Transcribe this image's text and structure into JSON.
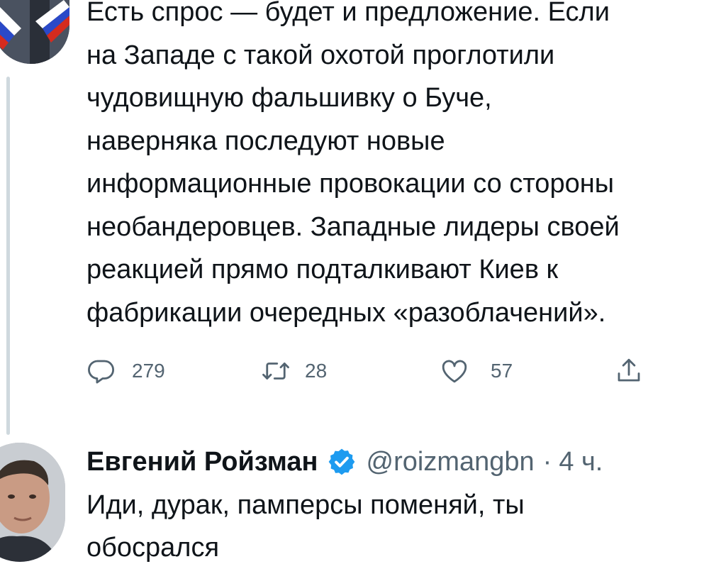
{
  "tweet1": {
    "lines": [
      "Есть спрос — будет и предложение. Если",
      "на Западе с такой охотой проглотили",
      "чудовищную фальшивку о Буче,",
      "наверняка последуют новые",
      "информационные провокации со стороны",
      "необандеровцев. Западные лидеры своей",
      "реакцией прямо подталкивают Киев к",
      "фабрикации очередных «разоблачений»."
    ],
    "actions": {
      "reply_icon": "reply-icon",
      "reply_count": "279",
      "retweet_icon": "retweet-icon",
      "retweet_count": "28",
      "like_icon": "heart-icon",
      "like_count": "57",
      "share_icon": "share-icon"
    },
    "avatar_icon": "avatar-with-russian-flag"
  },
  "tweet2": {
    "author_name": "Евгений Ройзман",
    "verified_icon": "verified-badge-icon",
    "handle": "@roizmangbn",
    "separator": "·",
    "time": "4 ч.",
    "lines": [
      "Иди, дурак, памперсы поменяй, ты",
      "обосрался"
    ],
    "avatar_icon": "avatar-photo"
  },
  "colors": {
    "text": "#0f1419",
    "secondary": "#536471",
    "verified": "#1d9bf0",
    "thread_line": "#cfd9de"
  }
}
